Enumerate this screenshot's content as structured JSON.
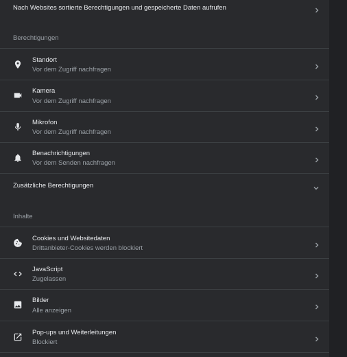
{
  "top_link": {
    "label": "Nach Websites sortierte Berechtigungen und gespeicherte Daten aufrufen"
  },
  "permissions": {
    "heading": "Berechtigungen",
    "items": [
      {
        "icon": "location-pin-icon",
        "title": "Standort",
        "subtitle": "Vor dem Zugriff nachfragen"
      },
      {
        "icon": "camera-icon",
        "title": "Kamera",
        "subtitle": "Vor dem Zugriff nachfragen"
      },
      {
        "icon": "microphone-icon",
        "title": "Mikrofon",
        "subtitle": "Vor dem Zugriff nachfragen"
      },
      {
        "icon": "bell-icon",
        "title": "Benachrichtigungen",
        "subtitle": "Vor dem Senden nachfragen"
      }
    ],
    "additional": {
      "label": "Zusätzliche Berechtigungen",
      "icon": "chevron-down-icon"
    }
  },
  "content": {
    "heading": "Inhalte",
    "items": [
      {
        "icon": "cookie-icon",
        "title": "Cookies und Websitedaten",
        "subtitle": "Drittanbieter-Cookies werden blockiert"
      },
      {
        "icon": "code-icon",
        "title": "JavaScript",
        "subtitle": "Zugelassen"
      },
      {
        "icon": "image-icon",
        "title": "Bilder",
        "subtitle": "Alle anzeigen"
      },
      {
        "icon": "open-in-new-icon",
        "title": "Pop-ups und Weiterleitungen",
        "subtitle": "Blockiert"
      }
    ]
  },
  "colors": {
    "background": "#202124",
    "card": "#292a2d",
    "text": "#e8eaed",
    "secondary_text": "#9aa0a6",
    "divider": "#3c4043"
  }
}
